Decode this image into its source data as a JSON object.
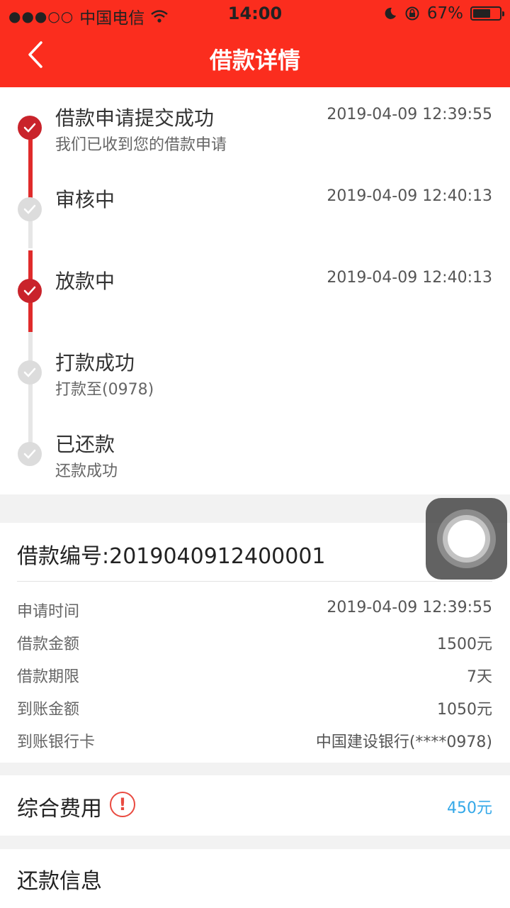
{
  "status_bar": {
    "signal": "●●●○○",
    "carrier": "中国电信",
    "time": "14:00",
    "battery": "67%",
    "battery_level": 0.67
  },
  "nav": {
    "back_icon": "chevron-left-icon",
    "title": "借款详情"
  },
  "timeline": [
    {
      "title": "借款申请提交成功",
      "subtitle": "我们已收到您的借款申请",
      "time": "2019-04-09 12:39:55",
      "state": "done"
    },
    {
      "title": "审核中",
      "subtitle": "",
      "time": "2019-04-09 12:40:13",
      "state": "pending"
    },
    {
      "title": "放款中",
      "subtitle": "",
      "time": "2019-04-09 12:40:13",
      "state": "done"
    },
    {
      "title": "打款成功",
      "subtitle": "打款至(0978)",
      "time": "",
      "state": "pending"
    },
    {
      "title": "已还款",
      "subtitle": "还款成功",
      "time": "",
      "state": "pending"
    }
  ],
  "loan": {
    "number_label": "借款编号:2019040912400001",
    "rows": [
      {
        "key": "申请时间",
        "value": "2019-04-09 12:39:55"
      },
      {
        "key": "借款金额",
        "value": "1500元"
      },
      {
        "key": "借款期限",
        "value": "7天"
      },
      {
        "key": "到账金额",
        "value": "1050元"
      },
      {
        "key": "到账银行卡",
        "value": "中国建设银行(****0978)"
      }
    ]
  },
  "fees": {
    "label": "综合费用",
    "warn_glyph": "!",
    "amount": "450元"
  },
  "repayment": {
    "label": "还款信息"
  },
  "colors": {
    "header": "#fb2d1e",
    "done": "#c9232b",
    "pending": "#dcdcdc",
    "fee_amount": "#34a8e8"
  }
}
